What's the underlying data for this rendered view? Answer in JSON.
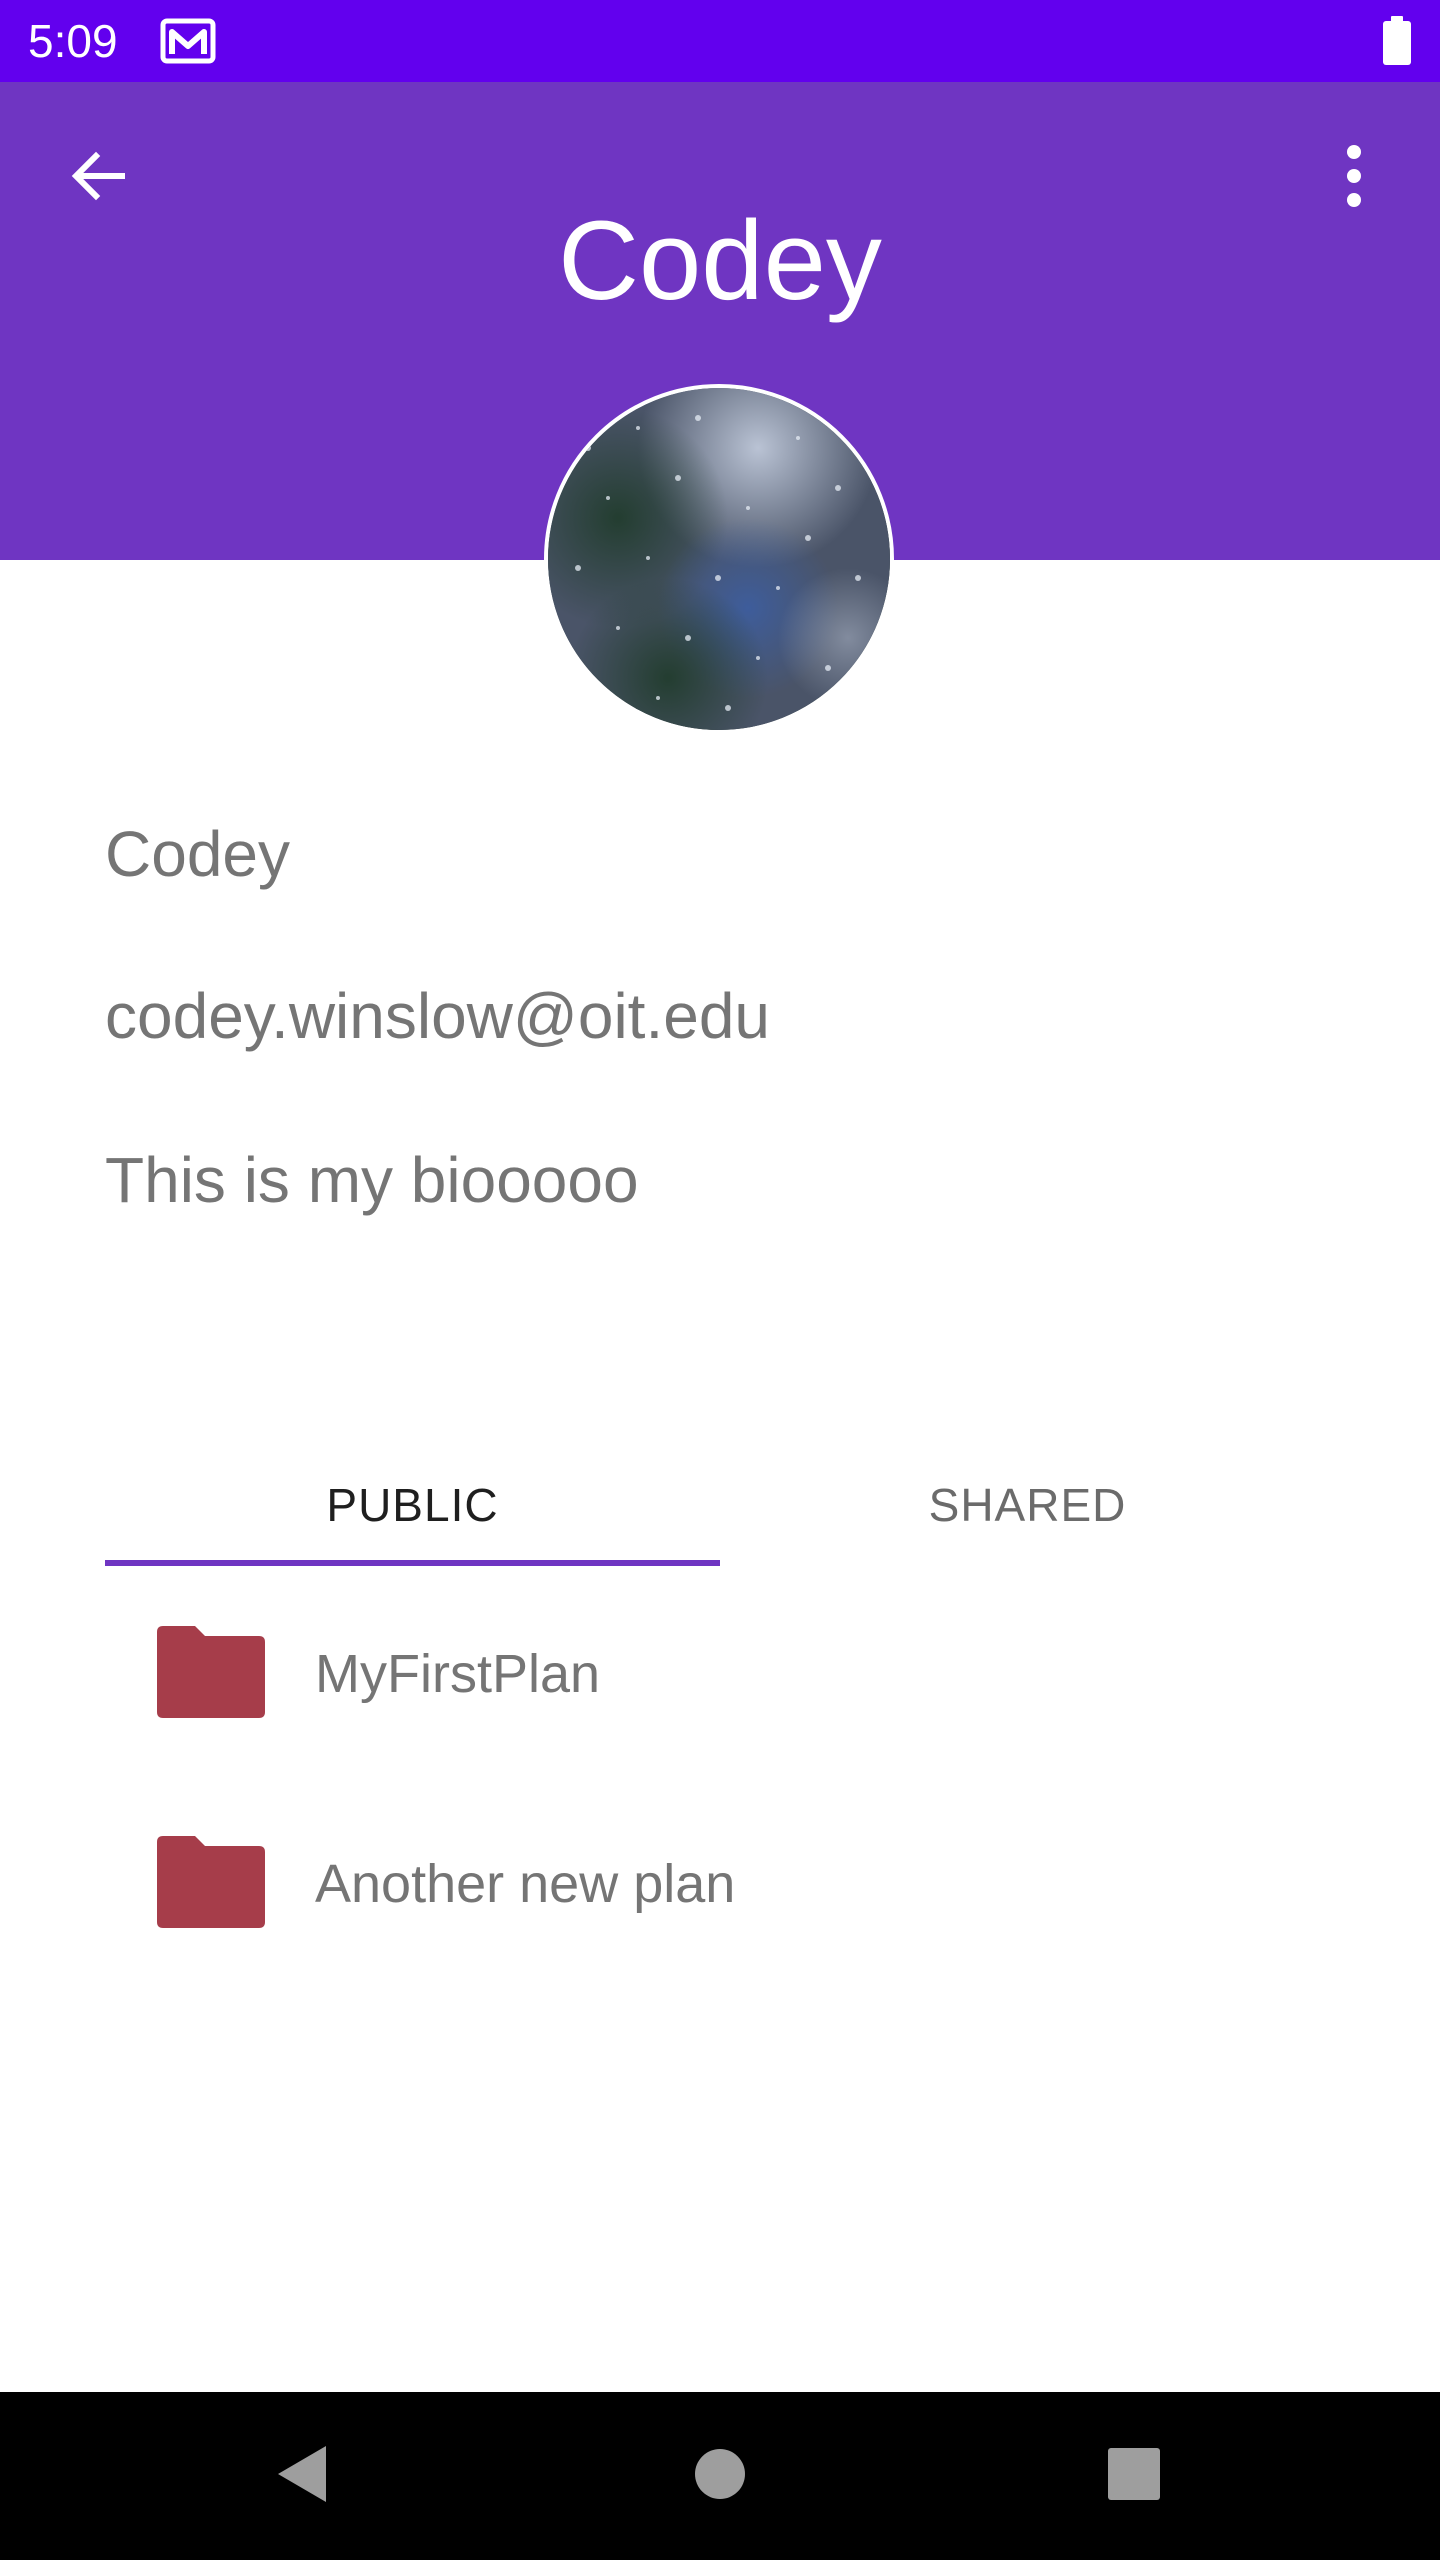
{
  "status_bar": {
    "time": "5:09",
    "notification_icon": "gmail-icon",
    "battery_icon": "battery-full-icon",
    "background_color": "#6200ee"
  },
  "header": {
    "title": "Codey",
    "back_icon": "arrow-back-icon",
    "menu_icon": "more-vert-icon",
    "background_color": "#6f35c2"
  },
  "profile": {
    "avatar": "rain-window-photo",
    "name": "Codey",
    "email": "codey.winslow@oit.edu",
    "bio": "This is my biooooo"
  },
  "tabs": [
    {
      "label": "PUBLIC",
      "selected": true
    },
    {
      "label": "SHARED",
      "selected": false
    }
  ],
  "plans": [
    {
      "name": "MyFirstPlan",
      "icon": "folder-icon"
    },
    {
      "name": "Another new plan",
      "icon": "folder-icon"
    }
  ],
  "accent_colors": {
    "tab_indicator": "#6f35c2",
    "folder": "#a63d4a"
  },
  "nav_bar": {
    "back_icon": "nav-back-icon",
    "home_icon": "nav-home-icon",
    "recents_icon": "nav-recents-icon"
  }
}
